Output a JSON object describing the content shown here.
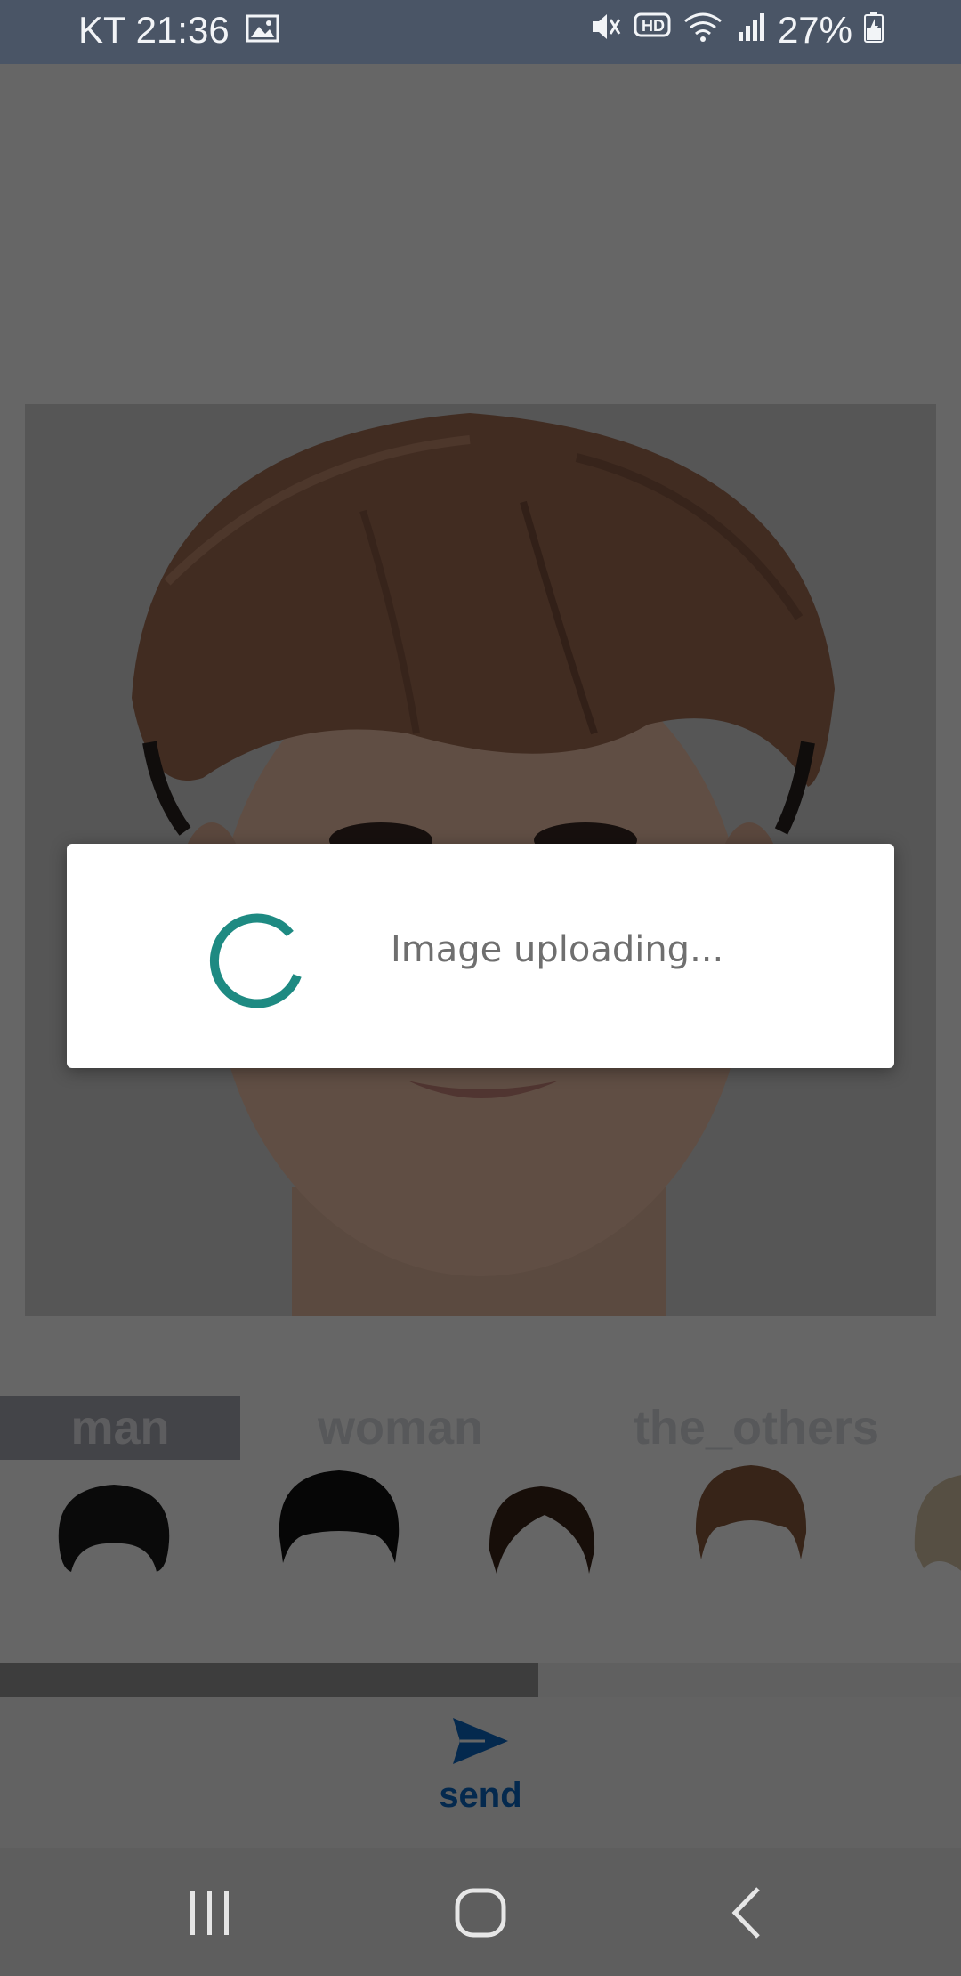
{
  "status_bar": {
    "carrier_time": "KT 21:36",
    "battery_percent": "27%",
    "icons": [
      "gallery-icon",
      "mute-icon",
      "hd-voice-icon",
      "wifi-icon",
      "signal-icon",
      "battery-charging-icon"
    ]
  },
  "tabs": [
    {
      "label": "man",
      "selected": true
    },
    {
      "label": "woman",
      "selected": false
    },
    {
      "label": "the_others",
      "selected": false
    }
  ],
  "hairstyles": [
    "short-black-curly",
    "black-bowl",
    "brown-parted",
    "light-brown-bowl",
    "blonde-partial"
  ],
  "upload_progress": 0.56,
  "send": {
    "label": "send",
    "icon": "send-icon"
  },
  "dialog": {
    "message": "Image uploading..."
  },
  "nav": {
    "icons": [
      "recent-apps-icon",
      "home-icon",
      "back-icon"
    ]
  },
  "colors": {
    "status_bar": "#4a5566",
    "spinner": "#1e8a82",
    "send": "#0a66c2",
    "nav": "#5e5e5e"
  }
}
